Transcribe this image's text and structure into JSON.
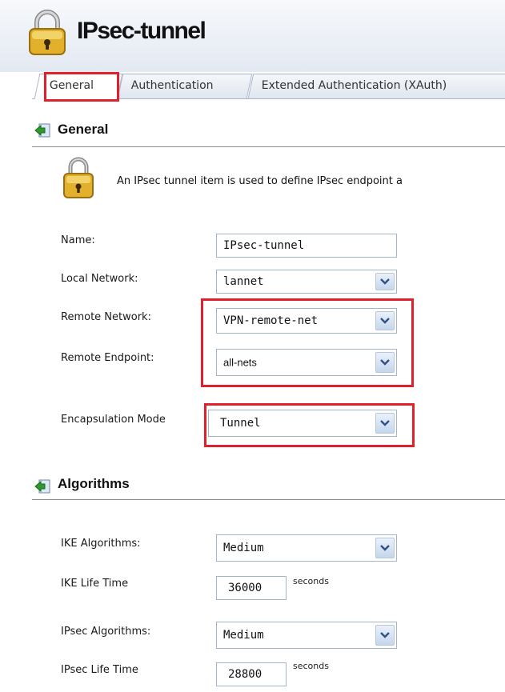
{
  "header": {
    "title": "IPsec-tunnel",
    "lock_icon": "padlock-icon"
  },
  "tabs": [
    {
      "label": "General",
      "active": true
    },
    {
      "label": "Authentication",
      "active": false
    },
    {
      "label": "Extended Authentication (XAuth)",
      "active": false
    }
  ],
  "general": {
    "heading": "General",
    "description": "An IPsec tunnel item is used to define IPsec endpoint a",
    "fields": {
      "name": {
        "label": "Name:",
        "value": "IPsec-tunnel"
      },
      "local_network": {
        "label": "Local Network:",
        "value": "lannet"
      },
      "remote_network": {
        "label": "Remote Network:",
        "value": "VPN-remote-net"
      },
      "remote_endpoint": {
        "label": "Remote Endpoint:",
        "value": "all-nets"
      },
      "encapsulation_mode": {
        "label": "Encapsulation Mode",
        "value": "Tunnel"
      }
    }
  },
  "algorithms": {
    "heading": "Algorithms",
    "fields": {
      "ike_algorithms": {
        "label": "IKE Algorithms:",
        "value": "Medium"
      },
      "ike_life_time": {
        "label": "IKE Life Time",
        "value": "36000",
        "unit": "seconds"
      },
      "ipsec_algorithms": {
        "label": "IPsec Algorithms:",
        "value": "Medium"
      },
      "ipsec_life_time": {
        "label": "IPsec Life Time",
        "value": "28800",
        "unit": "seconds"
      }
    }
  },
  "colors": {
    "highlight": "#e0202a",
    "header_bg": "#e3e9f2",
    "field_border": "#a5b5c9"
  }
}
